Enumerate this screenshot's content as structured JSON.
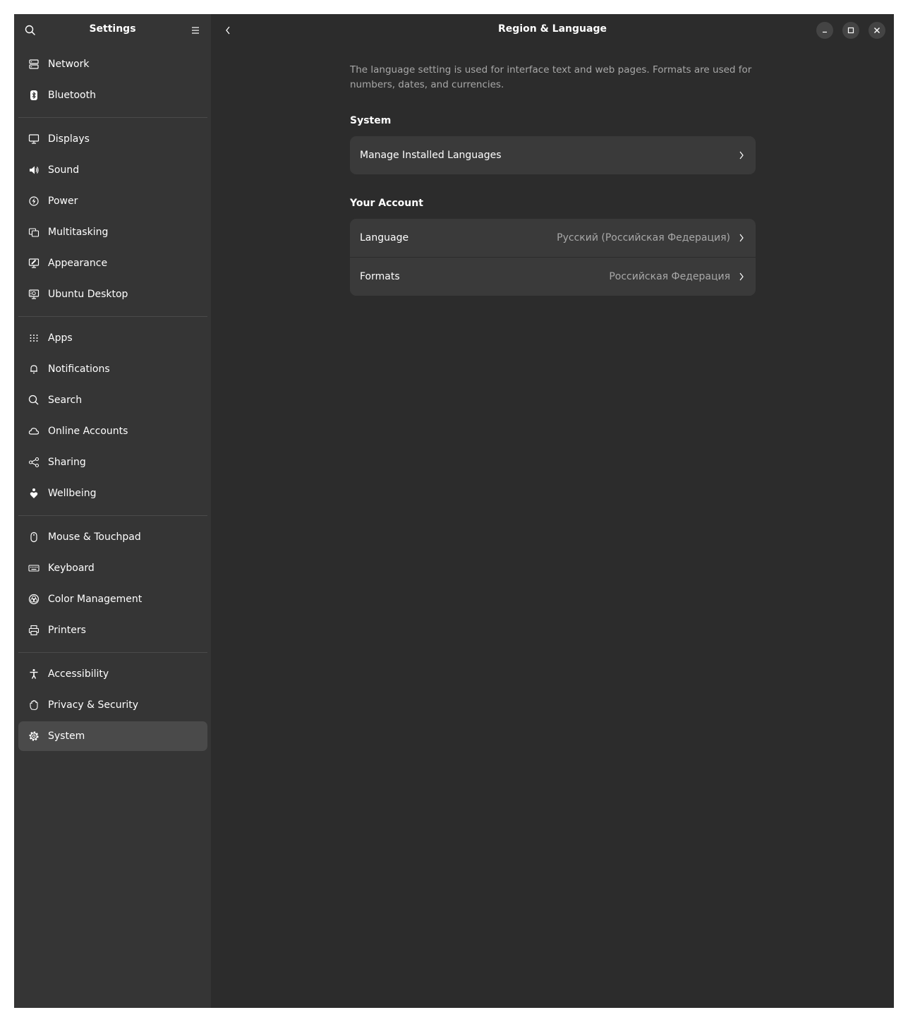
{
  "app": {
    "title": "Settings"
  },
  "sidebar": {
    "groups": [
      [
        {
          "label": "Network",
          "icon": "network-icon"
        },
        {
          "label": "Bluetooth",
          "icon": "bluetooth-icon"
        }
      ],
      [
        {
          "label": "Displays",
          "icon": "display-icon"
        },
        {
          "label": "Sound",
          "icon": "speaker-icon"
        },
        {
          "label": "Power",
          "icon": "power-icon"
        },
        {
          "label": "Multitasking",
          "icon": "multitasking-icon"
        },
        {
          "label": "Appearance",
          "icon": "appearance-icon"
        },
        {
          "label": "Ubuntu Desktop",
          "icon": "ubuntu-desktop-icon"
        }
      ],
      [
        {
          "label": "Apps",
          "icon": "apps-grid-icon"
        },
        {
          "label": "Notifications",
          "icon": "bell-icon"
        },
        {
          "label": "Search",
          "icon": "search-icon"
        },
        {
          "label": "Online Accounts",
          "icon": "cloud-icon"
        },
        {
          "label": "Sharing",
          "icon": "share-icon"
        },
        {
          "label": "Wellbeing",
          "icon": "wellbeing-icon"
        }
      ],
      [
        {
          "label": "Mouse & Touchpad",
          "icon": "mouse-icon"
        },
        {
          "label": "Keyboard",
          "icon": "keyboard-icon"
        },
        {
          "label": "Color Management",
          "icon": "color-icon"
        },
        {
          "label": "Printers",
          "icon": "printer-icon"
        }
      ],
      [
        {
          "label": "Accessibility",
          "icon": "accessibility-icon"
        },
        {
          "label": "Privacy & Security",
          "icon": "hand-icon"
        },
        {
          "label": "System",
          "icon": "gear-icon",
          "active": true
        }
      ]
    ]
  },
  "page": {
    "title": "Region & Language",
    "description": "The language setting is used for interface text and web pages. Formats are used for numbers, dates, and currencies.",
    "system_section": {
      "title": "System",
      "rows": [
        {
          "label": "Manage Installed Languages",
          "value": ""
        }
      ]
    },
    "account_section": {
      "title": "Your Account",
      "rows": [
        {
          "label": "Language",
          "value": "Русский (Российская Федерация)"
        },
        {
          "label": "Formats",
          "value": "Российская Федерация"
        }
      ]
    }
  },
  "colors": {
    "window_bg": "#2c2c2c",
    "sidebar_bg": "#353535",
    "card_bg": "#3a3a3a",
    "active_item_bg": "#4a4a4a",
    "dim_text": "#a8a8a8"
  }
}
